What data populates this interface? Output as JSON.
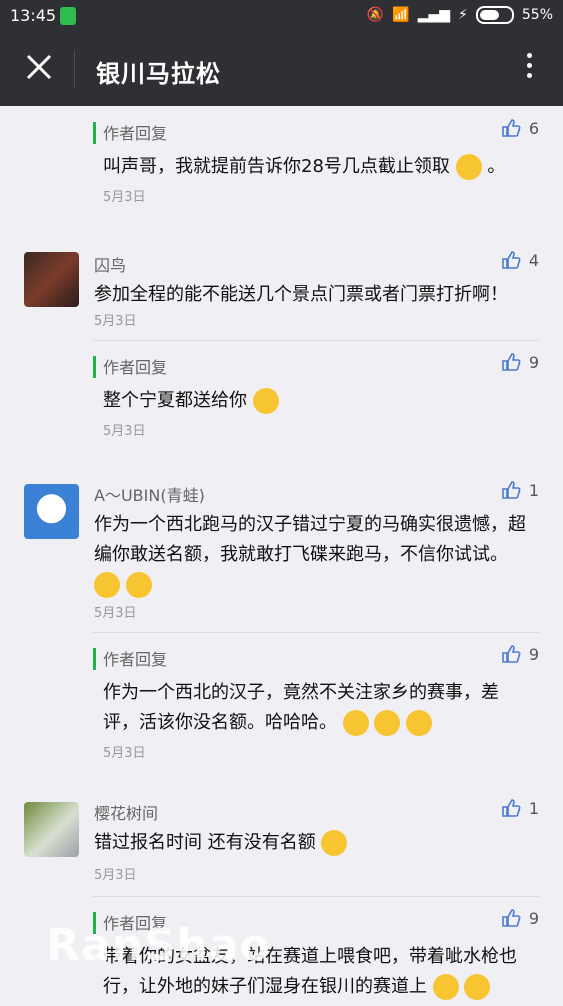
{
  "status": {
    "time": "13:45",
    "battery": "55%"
  },
  "header": {
    "title": "银川马拉松"
  },
  "replies_top": {
    "name": "作者回复",
    "text": "叫声哥，我就提前告诉你28号几点截止领取",
    "suffix": "。",
    "date": "5月3日",
    "likes": "6"
  },
  "comments": [
    {
      "name": "囚鸟",
      "text": "参加全程的能不能送几个景点门票或者门票打折啊！",
      "date": "5月3日",
      "likes": "4",
      "reply": {
        "name": "作者回复",
        "text": "整个宁夏都送给你",
        "date": "5月3日",
        "likes": "9"
      }
    },
    {
      "name": "A～UBIN(青蛙)",
      "text": "作为一个西北跑马的汉子错过宁夏的马确实很遗憾，超编你敢送名额，我就敢打飞碟来跑马，不信你试试。",
      "date": "5月3日",
      "likes": "1",
      "reply": {
        "name": "作者回复",
        "text": "作为一个西北的汉子，竟然不关注家乡的赛事，差评，活该你没名额。哈哈哈。",
        "date": "5月3日",
        "likes": "9"
      }
    },
    {
      "name": "樱花树间",
      "text": "错过报名时间 还有没有名额",
      "date": "5月3日",
      "likes": "1",
      "reply": {
        "name": "作者回复",
        "text": "带着你的女盆友，站在赛道上喂食吧，带着呲水枪也行，让外地的妹子们湿身在银川的赛道上",
        "date": "",
        "likes": "9"
      }
    }
  ],
  "watermark": "RanShao",
  "icons": {
    "close": "close-icon",
    "more": "more-icon",
    "thumb": "thumb-up-icon"
  },
  "colors": {
    "bar": "#2e3034",
    "accent": "#20b34a",
    "bg": "#efeff4"
  }
}
